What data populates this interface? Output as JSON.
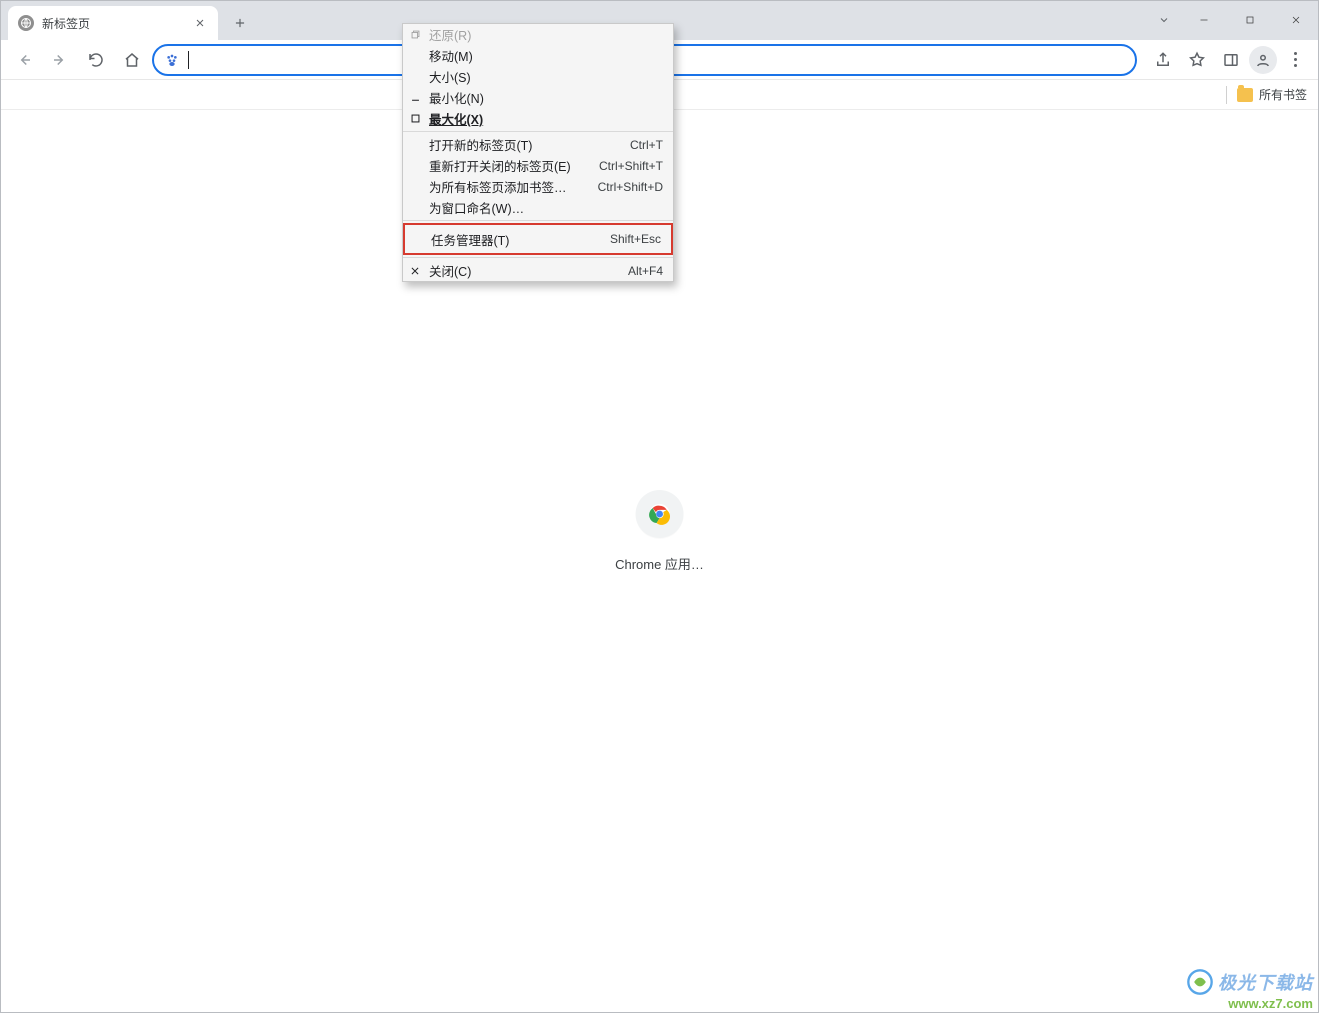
{
  "tab": {
    "title": "新标签页"
  },
  "omnibox": {
    "placeholder": ""
  },
  "bookmark_bar": {
    "all_bookmarks": "所有书签"
  },
  "content": {
    "apps_label": "Chrome 应用…"
  },
  "context_menu": {
    "items": [
      {
        "label": "还原(R)",
        "shortcut": "",
        "icon": "restore",
        "disabled": true
      },
      {
        "label": "移动(M)",
        "shortcut": "",
        "icon": "",
        "disabled": false
      },
      {
        "label": "大小(S)",
        "shortcut": "",
        "icon": "",
        "disabled": false
      },
      {
        "label": "最小化(N)",
        "shortcut": "",
        "icon": "minimize",
        "disabled": false
      },
      {
        "label": "最大化(X)",
        "shortcut": "",
        "icon": "maximize",
        "disabled": false,
        "bold": true
      }
    ],
    "items2": [
      {
        "label": "打开新的标签页(T)",
        "shortcut": "Ctrl+T"
      },
      {
        "label": "重新打开关闭的标签页(E)",
        "shortcut": "Ctrl+Shift+T"
      },
      {
        "label": "为所有标签页添加书签…",
        "shortcut": "Ctrl+Shift+D"
      },
      {
        "label": "为窗口命名(W)…",
        "shortcut": ""
      }
    ],
    "highlight": {
      "label": "任务管理器(T)",
      "shortcut": "Shift+Esc"
    },
    "items3": [
      {
        "label": "关闭(C)",
        "shortcut": "Alt+F4",
        "icon": "close"
      }
    ]
  },
  "watermark": {
    "title": "极光下载站",
    "url": "www.xz7.com"
  }
}
